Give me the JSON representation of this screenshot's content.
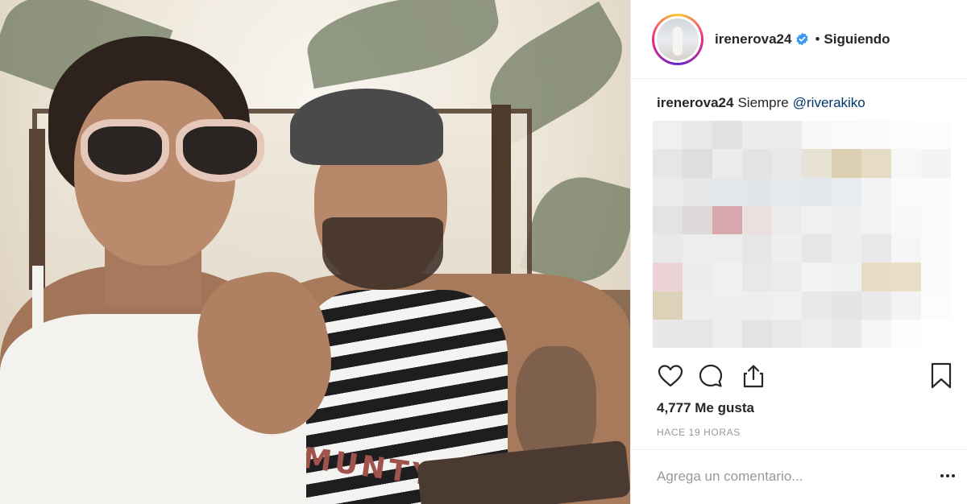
{
  "post": {
    "username": "irenerova24",
    "verified": true,
    "separator": "•",
    "follow_status": "Siguiendo",
    "caption": {
      "username": "irenerova24",
      "text": "Siempre",
      "mention": "@riverakiko"
    },
    "likes_text": "4,777 Me gusta",
    "timestamp": "HACE 19 HORAS",
    "comment_placeholder": "Agrega un comentario...",
    "photo_print_text": "MUNTY"
  },
  "icons": {
    "like": "heart-outline-icon",
    "comment": "speech-bubble-icon",
    "share": "share-upload-icon",
    "save": "bookmark-icon",
    "more": "more-dots-icon",
    "verified": "verified-badge-icon"
  },
  "colors": {
    "text": "#262626",
    "mention": "#003569",
    "muted": "#999999",
    "verified": "#3897f0",
    "divider": "#efefef"
  },
  "blurred_comments_mosaic": [
    [
      "#f0f0f0",
      "#e8e8e8",
      "#e2e2e2",
      "#ececec",
      "#ebebeb",
      "#f7f7f7",
      "#fafafa",
      "#fbfbfb",
      "#fcfcfc",
      "#fdfdfd"
    ],
    [
      "#e6e6e6",
      "#dedede",
      "#ececec",
      "#e4e4e4",
      "#e8e8e8",
      "#e8e2d4",
      "#ddd0b2",
      "#e6dcc6",
      "#f7f7f7",
      "#f4f4f4"
    ],
    [
      "#ebebeb",
      "#e7e7e7",
      "#e4e8ec",
      "#e2e6ea",
      "#e5e9ed",
      "#e3e8ec",
      "#e8ecef",
      "#f3f3f3",
      "#fafafa",
      "#fbfbfb"
    ],
    [
      "#e3e3e3",
      "#ddd8d8",
      "#d7a7ad",
      "#ecdfe0",
      "#ececec",
      "#f1f1f1",
      "#efefef",
      "#f3f3f3",
      "#f8f8f8",
      "#fafafa"
    ],
    [
      "#e9e9e9",
      "#ededed",
      "#ededed",
      "#e6e6e6",
      "#efefef",
      "#e6e6e6",
      "#eeeeee",
      "#e8e8e8",
      "#f6f6f6",
      "#fbfbfb"
    ],
    [
      "#ecd3d7",
      "#ececec",
      "#f1f1f1",
      "#e8e8e8",
      "#ebebeb",
      "#f4f4f4",
      "#f0f0f0",
      "#e7ddc4",
      "#e9dfc7",
      "#fafafa"
    ],
    [
      "#dcd2b8",
      "#eeeeee",
      "#efefef",
      "#eeeeee",
      "#f0f0f0",
      "#e9e9e9",
      "#e5e5e5",
      "#eaeaea",
      "#f3f3f3",
      "#fcfcfc"
    ],
    [
      "#e7e7e7",
      "#e6e6e6",
      "#ededed",
      "#e4e4e4",
      "#e8e8e8",
      "#ededed",
      "#eaeaea",
      "#f5f5f5",
      "#fdfdfd",
      "#ffffff"
    ]
  ]
}
